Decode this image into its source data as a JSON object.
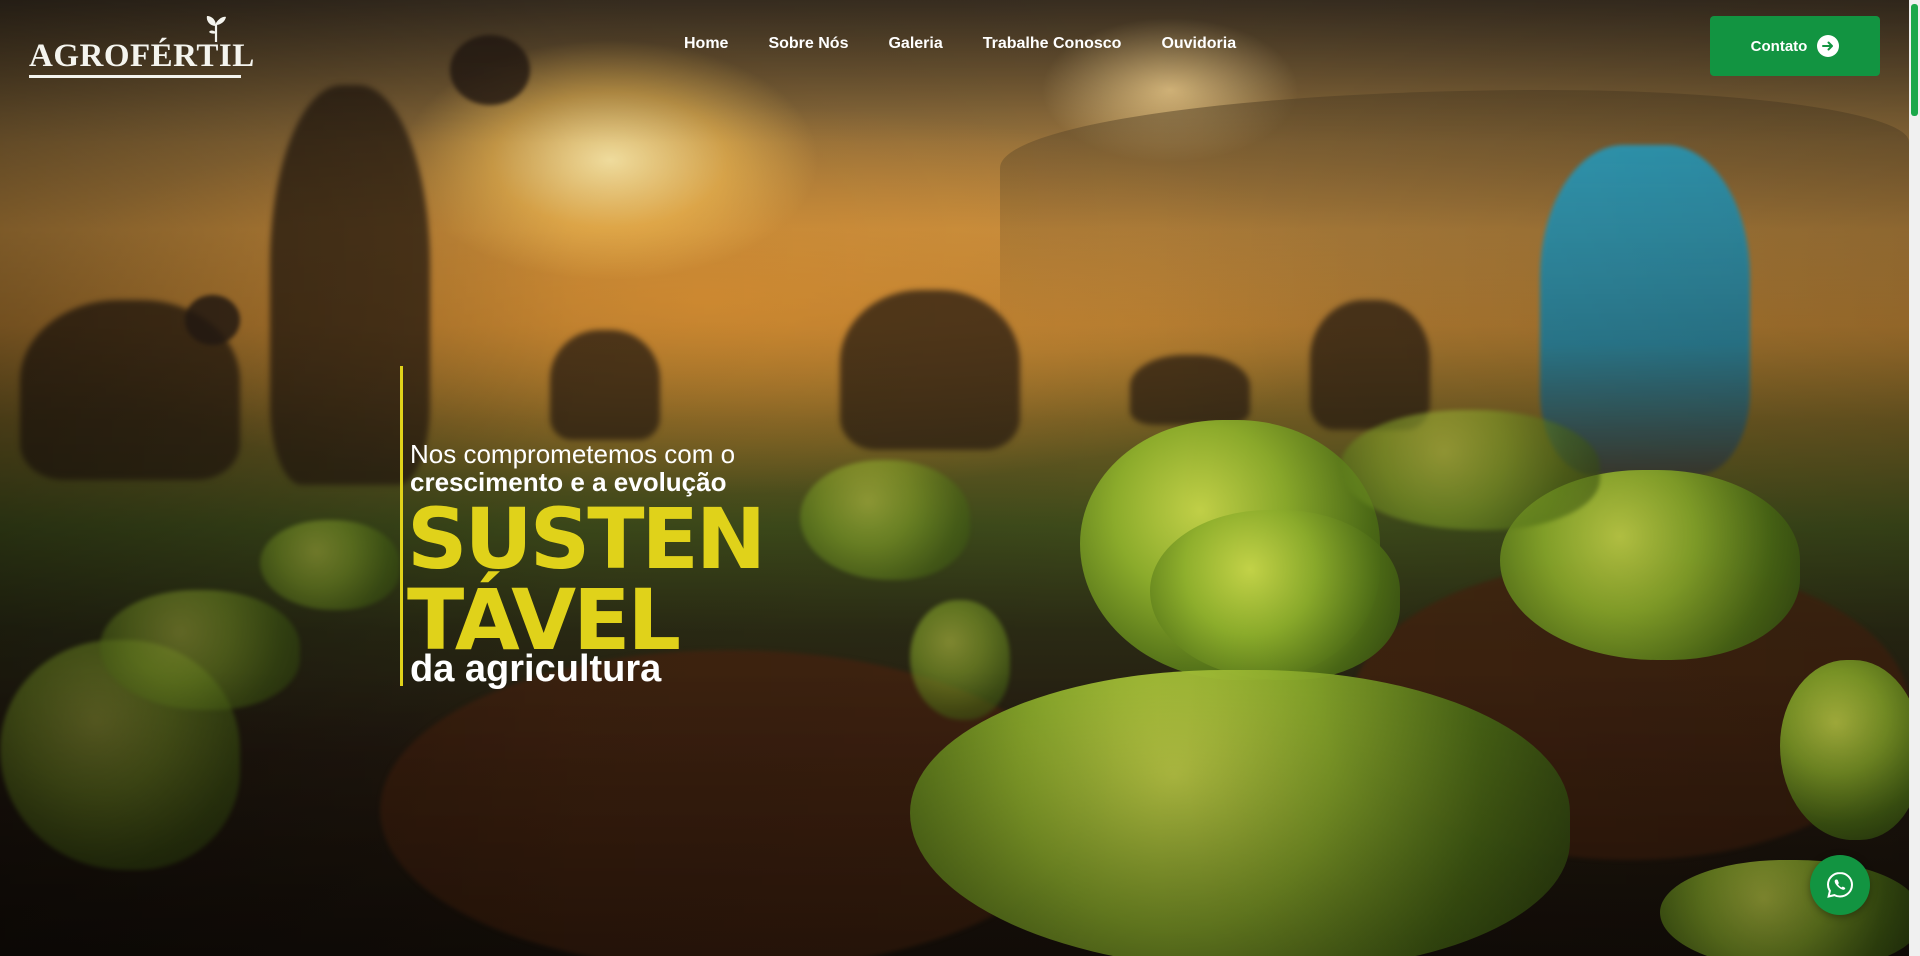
{
  "brand": {
    "logo_text": "AGROFÉRTIL",
    "accent_color": "#e0d21a",
    "primary_color": "#129441"
  },
  "nav": {
    "items": [
      {
        "label": "Home"
      },
      {
        "label": "Sobre Nós"
      },
      {
        "label": "Galeria"
      },
      {
        "label": "Trabalhe Conosco"
      },
      {
        "label": "Ouvidoria"
      }
    ]
  },
  "header": {
    "contact_label": "Contato",
    "contact_icon": "arrow-right-circle-icon"
  },
  "hero": {
    "line1": "Nos comprometemos com o",
    "line2": "crescimento e a evolução",
    "big_word_1": "SUSTEN",
    "big_word_2": "TÁVEL",
    "line3": "da agricultura"
  },
  "floating": {
    "whatsapp_icon": "whatsapp-icon"
  }
}
